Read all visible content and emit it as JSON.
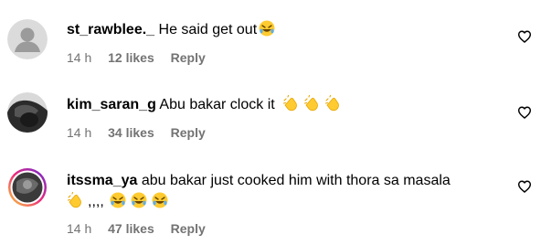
{
  "comments": [
    {
      "username": "st_rawblee._",
      "text": "He said get out",
      "emojis": [
        "rolling-laughing-emoji"
      ],
      "time": "14 h",
      "likes": "12 likes",
      "reply": "Reply"
    },
    {
      "username": "kim_saran_g",
      "text": "Abu bakar clock it",
      "emojis": [
        "clap-emoji",
        "clap-emoji",
        "clap-emoji"
      ],
      "time": "14 h",
      "likes": "34 likes",
      "reply": "Reply"
    },
    {
      "username": "itssma_ya",
      "text": "abu bakar just cooked him with thora sa masala",
      "line2_text": ",,,,",
      "emojis": [
        "clap-emoji",
        "rolling-laughing-emoji",
        "rolling-laughing-emoji",
        "rolling-laughing-emoji"
      ],
      "time": "14 h",
      "likes": "47 likes",
      "reply": "Reply"
    }
  ],
  "colors": {
    "meta": "#737373",
    "text": "#000000",
    "story_ring_start": "#f9ce34",
    "story_ring_end": "#ee2a7b"
  }
}
